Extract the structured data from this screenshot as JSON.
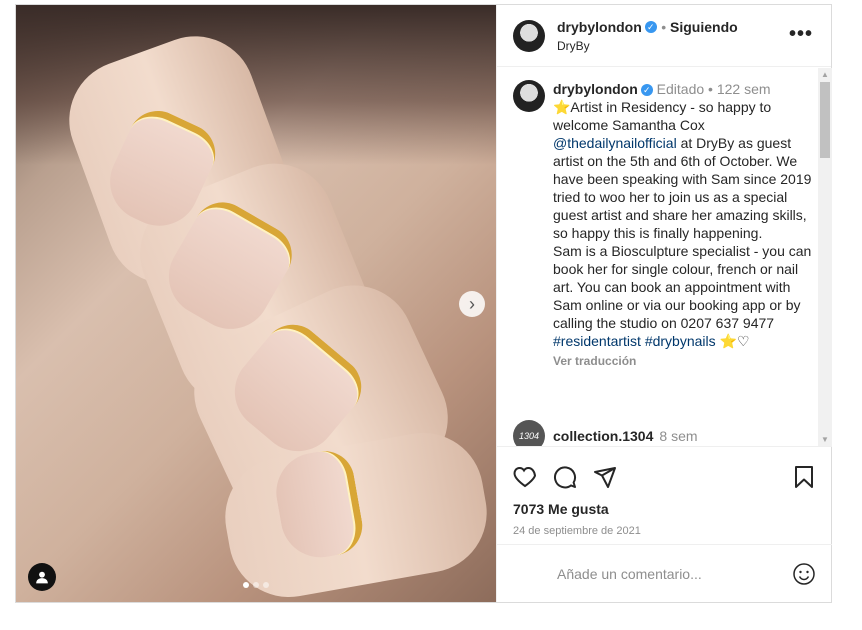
{
  "post": {
    "username": "drybylondon",
    "follow_status": "Siguiendo",
    "subtitle": "DryBy",
    "more_icon": "•••",
    "caption": {
      "username": "drybylondon",
      "edited": "Editado",
      "separator": "•",
      "time": "122 sem",
      "text_1": "⭐Artist in Residency - so happy to welcome Samantha Cox",
      "mention": "@thedailynailofficial",
      "text_2": "at DryBy as guest artist on the 5th and 6th of October. We have been speaking with Sam since 2019 tried to woo her to join us as a special guest artist and share her amazing skills, so happy this is finally happening.",
      "text_3": "Sam is a Biosculpture specialist - you can book her for single colour, french or nail art. You can book an appointment with Sam online or via our booking app or by calling the studio on 0207 637 9477",
      "hashtags": "#residentartist #drybynails",
      "tail": " ⭐♡",
      "translate": "Ver traducción"
    },
    "comment": {
      "avatar_text": "1304",
      "username": "collection.1304",
      "time": "8 sem"
    },
    "likes": "7073 Me gusta",
    "date": "24 de septiembre de 2021",
    "comment_placeholder": "Añade un comentario..."
  },
  "icons": {
    "like": "heart-icon",
    "comment": "comment-icon",
    "share": "share-icon",
    "save": "bookmark-icon",
    "emoji": "emoji-icon",
    "next": "chevron-right-icon",
    "user_tag": "user-icon"
  },
  "carousel": {
    "total": 3,
    "active": 1
  }
}
